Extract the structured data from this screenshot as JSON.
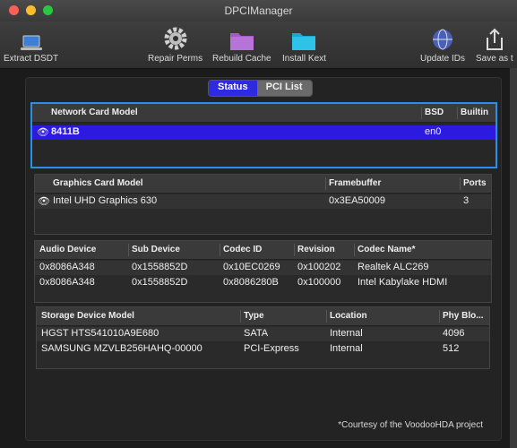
{
  "window": {
    "title": "DPCIManager"
  },
  "toolbar": [
    {
      "label": "Extract DSDT",
      "icon": "laptop-icon"
    },
    {
      "label": "Repair Perms",
      "icon": "gear-icon"
    },
    {
      "label": "Rebuild Cache",
      "icon": "folder-icon"
    },
    {
      "label": "Install Kext",
      "icon": "folder-icon"
    },
    {
      "label": "Update IDs",
      "icon": "globe-icon"
    },
    {
      "label": "Save as t",
      "icon": "share-icon"
    }
  ],
  "tabs": {
    "status": "Status",
    "pci_list": "PCI List"
  },
  "network": {
    "headers": [
      "Network Card Model",
      "BSD",
      "Builtin"
    ],
    "rows": [
      {
        "model": "8411B",
        "bsd": "en0",
        "builtin": ""
      }
    ]
  },
  "graphics": {
    "headers": [
      "Graphics Card Model",
      "Framebuffer",
      "Ports"
    ],
    "rows": [
      {
        "model": "Intel UHD Graphics 630",
        "framebuffer": "0x3EA50009",
        "ports": "3"
      }
    ]
  },
  "audio": {
    "headers": [
      "Audio Device",
      "Sub Device",
      "Codec ID",
      "Revision",
      "Codec Name*"
    ],
    "rows": [
      {
        "device": "0x8086A348",
        "sub": "0x1558852D",
        "codec": "0x10EC0269",
        "rev": "0x100202",
        "name": "Realtek ALC269"
      },
      {
        "device": "0x8086A348",
        "sub": "0x1558852D",
        "codec": "0x8086280B",
        "rev": "0x100000",
        "name": "Intel Kabylake HDMI"
      }
    ]
  },
  "storage": {
    "headers": [
      "Storage Device Model",
      "Type",
      "Location",
      "Phy Blo..."
    ],
    "rows": [
      {
        "model": "HGST HTS541010A9E680",
        "type": "SATA",
        "location": "Internal",
        "phy": "4096"
      },
      {
        "model": "SAMSUNG MZVLB256HAHQ-00000",
        "type": "PCI-Express",
        "location": "Internal",
        "phy": "512"
      }
    ]
  },
  "footer": "*Courtesy of the VoodooHDA project",
  "colors": {
    "selection": "#2d1ae0",
    "focus_ring": "#2a8fe8",
    "tab_active": "#2d2adf"
  }
}
